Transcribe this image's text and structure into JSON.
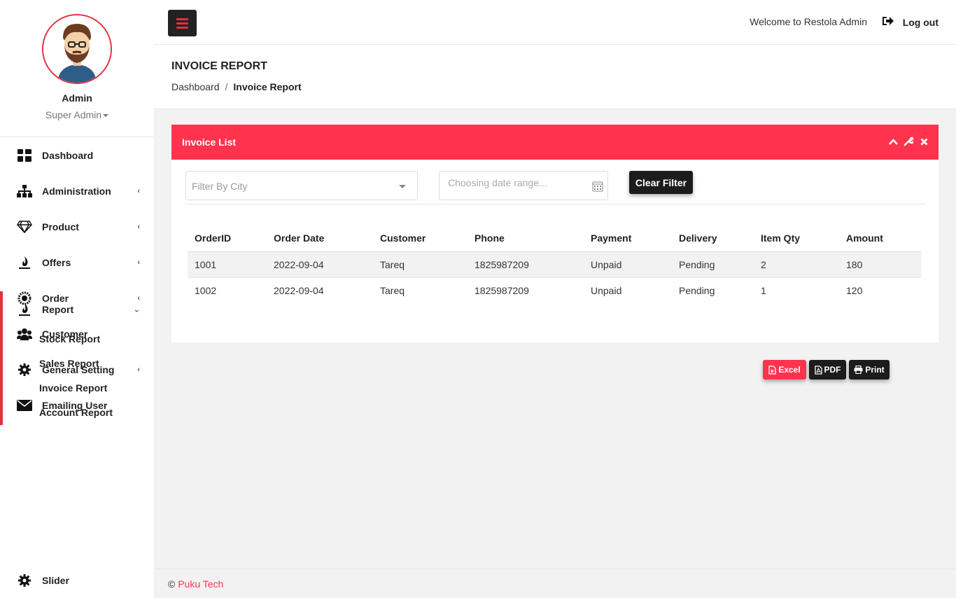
{
  "sidebar": {
    "profile": {
      "name": "Admin",
      "role": "Super Admin"
    },
    "menu": [
      {
        "label": "Dashboard",
        "icon": "dashboard-icon",
        "has_submenu": false
      },
      {
        "label": "Administration",
        "icon": "sitemap-icon",
        "has_submenu": true
      },
      {
        "label": "Product",
        "icon": "diamond-icon",
        "has_submenu": true
      },
      {
        "label": "Offers",
        "icon": "fire-icon",
        "has_submenu": true
      },
      {
        "label": "Order",
        "icon": "order-icon",
        "has_submenu": true
      },
      {
        "label": "Customer",
        "icon": "users-icon",
        "has_submenu": false
      },
      {
        "label": "General Setting",
        "icon": "gear-icon",
        "has_submenu": true
      },
      {
        "label": "Emailing User",
        "icon": "envelope-icon",
        "has_submenu": false
      }
    ],
    "report": {
      "label": "Report",
      "icon": "fire-icon",
      "submenu": [
        "Stock Report",
        "Sales Report",
        "Invoice Report",
        "Account Report"
      ]
    },
    "slider": {
      "label": "Slider",
      "icon": "gear-icon"
    }
  },
  "topbar": {
    "welcome": "Welcome to Restola Admin",
    "logout": "Log out"
  },
  "page": {
    "title": "INVOICE REPORT",
    "breadcrumb": {
      "home": "Dashboard",
      "separator": "/",
      "current": "Invoice Report"
    }
  },
  "panel": {
    "title": "Invoice List",
    "filters": {
      "city_placeholder": "Filter By City",
      "date_placeholder": "Choosing date range...",
      "clear_label": "Clear Filter"
    },
    "table": {
      "headers": [
        "OrderID",
        "Order Date",
        "Customer",
        "Phone",
        "Payment",
        "Delivery",
        "Item Qty",
        "Amount"
      ],
      "rows": [
        [
          "1001",
          "2022-09-04",
          "Tareq",
          "1825987209",
          "Unpaid",
          "Pending",
          "2",
          "180"
        ],
        [
          "1002",
          "2022-09-04",
          "Tareq",
          "1825987209",
          "Unpaid",
          "Pending",
          "1",
          "120"
        ]
      ]
    }
  },
  "exports": {
    "excel": "Excel",
    "pdf": "PDF",
    "print": "Print"
  },
  "footer": {
    "copyright": "©",
    "brand": "Puku Tech"
  },
  "colors": {
    "accent": "#ff334d",
    "dark": "#1c1c1c",
    "background": "#f2f2f2"
  }
}
